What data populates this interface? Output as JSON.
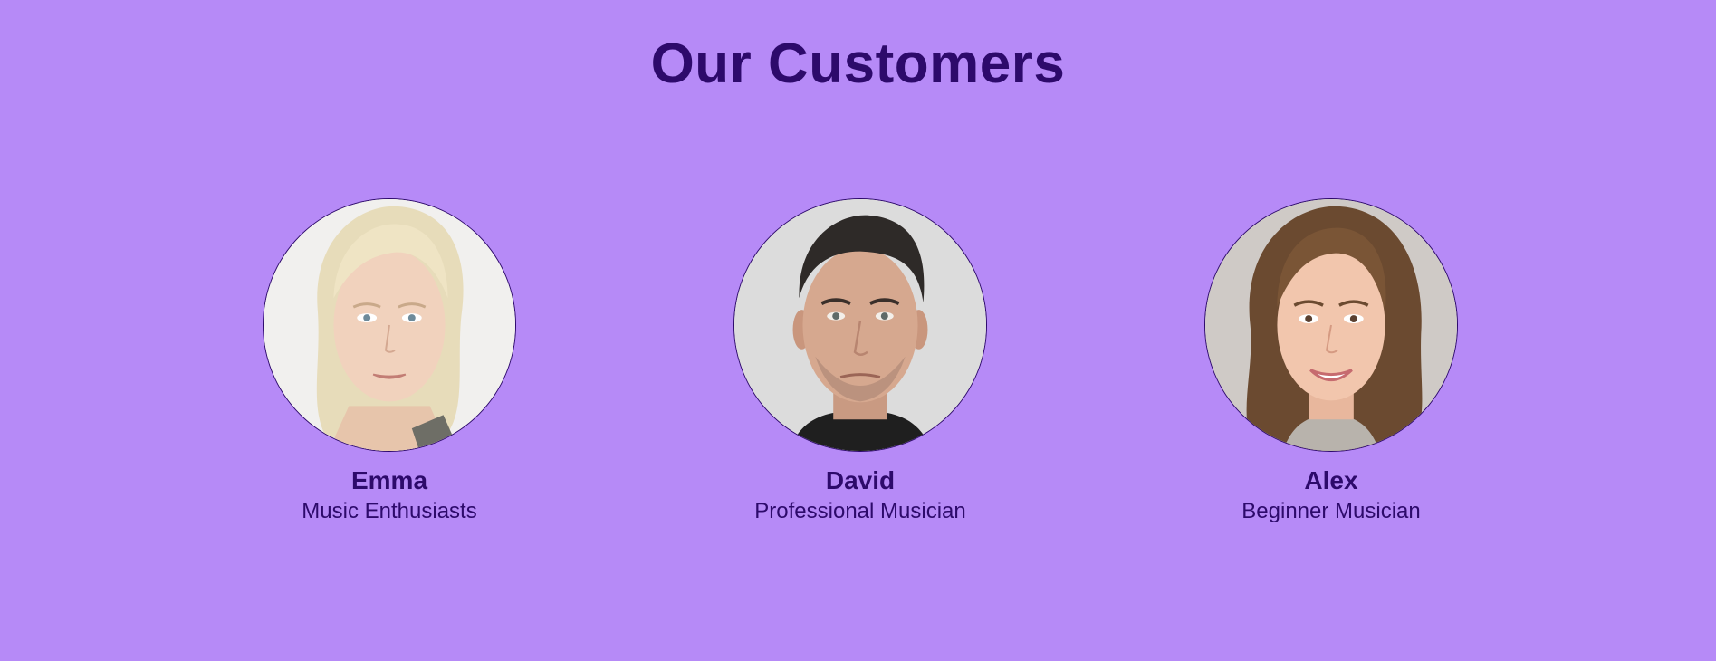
{
  "section": {
    "title": "Our Customers",
    "colors": {
      "background": "#b68af7",
      "text": "#2d0a6b"
    }
  },
  "customers": [
    {
      "name": "Emma",
      "role": "Music Enthusiasts",
      "photo": "avatar-blonde-woman"
    },
    {
      "name": "David",
      "role": "Professional Musician",
      "photo": "avatar-dark-haired-man"
    },
    {
      "name": "Alex",
      "role": "Beginner Musician",
      "photo": "avatar-brown-haired-woman"
    }
  ]
}
